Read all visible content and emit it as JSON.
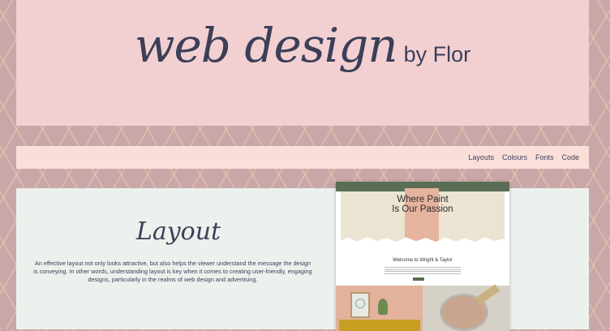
{
  "header": {
    "title_script": "web design",
    "title_by": "by Flor"
  },
  "nav": {
    "items": [
      "Layouts",
      "Colours",
      "Fonts",
      "Code"
    ]
  },
  "section": {
    "title": "Layout",
    "text": "An effective layout not only looks attractive, but also helps the viewer understand the message the design is conveying. In other words, understanding layout is key when it comes to creating user-friendly, engaging designs, particularly in the realms of web design and advertising."
  },
  "preview": {
    "heading_line1": "Where Paint",
    "heading_line2": "Is Our Passion",
    "welcome": "Welcome to Wright & Taylor"
  },
  "colors": {
    "header_bg": "#f2d0d2",
    "nav_bg": "#fadfd9",
    "main_bg": "#ecf1ee",
    "text": "#3c3f57",
    "pattern_bg": "#c9a7a8"
  }
}
